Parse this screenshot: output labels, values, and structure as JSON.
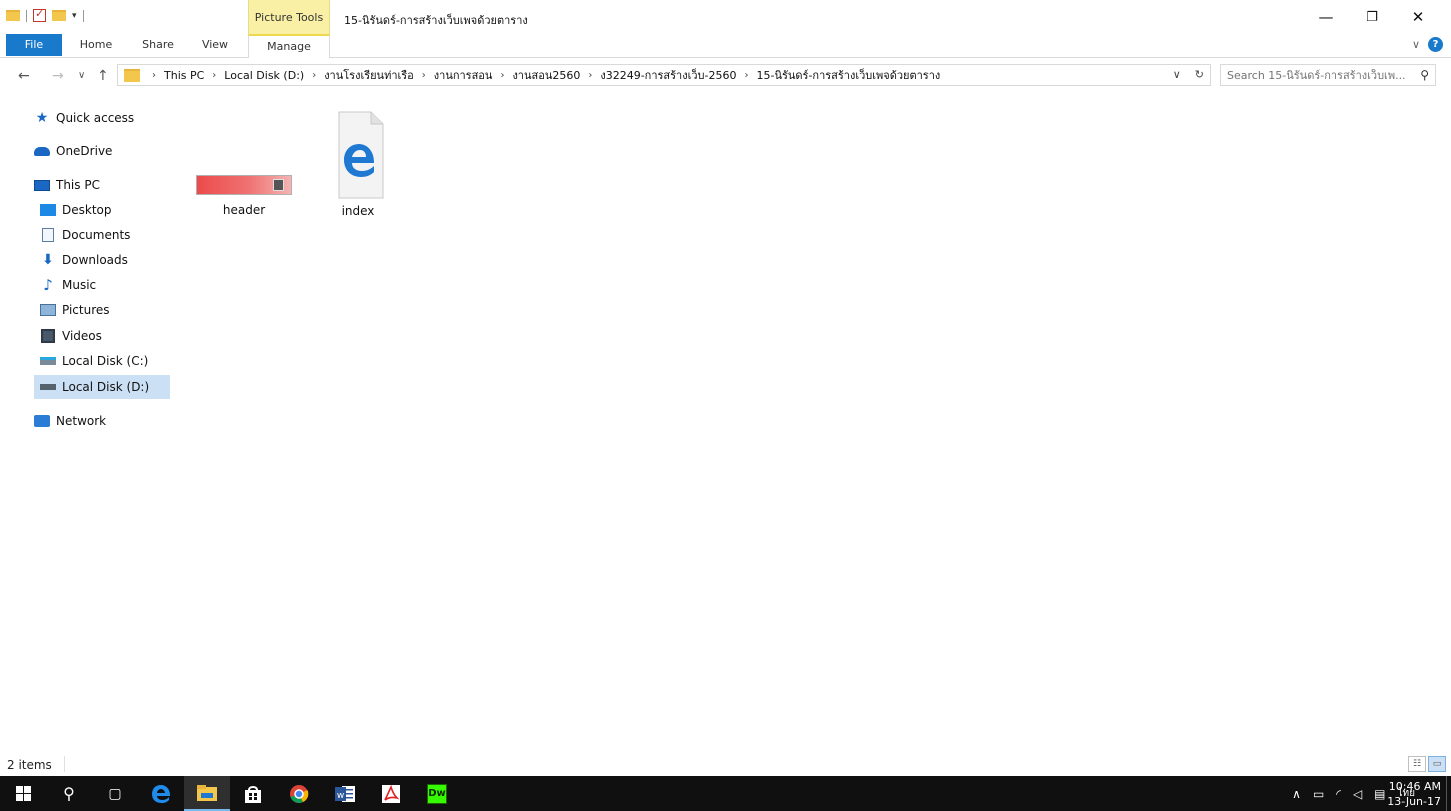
{
  "window": {
    "context_tab_group": "Picture Tools",
    "title": "15-นิรันดร์-การสร้างเว็บเพจด้วยตาราง",
    "minimize": "—",
    "restore": "❐",
    "close": "✕"
  },
  "ribbon": {
    "tabs": [
      {
        "label": "File"
      },
      {
        "label": "Home"
      },
      {
        "label": "Share"
      },
      {
        "label": "View"
      },
      {
        "label": "Manage"
      }
    ],
    "help": "?"
  },
  "address": {
    "crumbs": [
      "This PC",
      "Local Disk (D:)",
      "งานโรงเรียนท่าเรือ",
      "งานการสอน",
      "งานสอน2560",
      "ง32249-การสร้างเว็บ-2560",
      "15-นิรันดร์-การสร้างเว็บเพจด้วยตาราง"
    ],
    "search_placeholder": "Search 15-นิรันดร์-การสร้างเว็บเพ..."
  },
  "nav": {
    "items": [
      {
        "label": "Quick access",
        "icon": "quick-access-star-icon"
      },
      {
        "label": "OneDrive",
        "icon": "onedrive-cloud-icon"
      },
      {
        "label": "This PC",
        "icon": "this-pc-icon"
      },
      {
        "label": "Desktop",
        "icon": "desktop-icon"
      },
      {
        "label": "Documents",
        "icon": "documents-icon"
      },
      {
        "label": "Downloads",
        "icon": "downloads-icon"
      },
      {
        "label": "Music",
        "icon": "music-icon"
      },
      {
        "label": "Pictures",
        "icon": "pictures-icon"
      },
      {
        "label": "Videos",
        "icon": "videos-icon"
      },
      {
        "label": "Local Disk (C:)",
        "icon": "local-disk-c-icon"
      },
      {
        "label": "Local Disk (D:)",
        "icon": "local-disk-d-icon",
        "selected": true
      },
      {
        "label": "Network",
        "icon": "network-icon"
      }
    ]
  },
  "files": [
    {
      "name": "header",
      "type": "image",
      "icon": "image-thumbnail"
    },
    {
      "name": "index",
      "type": "html",
      "icon": "edge-html-file-icon"
    }
  ],
  "status": {
    "item_count": "2 items"
  },
  "taskbar": {
    "tray_language": "ไทย",
    "time": "10:46 AM",
    "date": "13-Jun-17",
    "apps": [
      "start",
      "search",
      "task-view",
      "edge",
      "file-explorer",
      "store",
      "chrome",
      "word",
      "acrobat",
      "dreamweaver"
    ],
    "dreamweaver_label": "Dw"
  },
  "colors": {
    "file_tab_blue": "#1979ca",
    "context_tab_yellow": "#f9f0a6",
    "selection_blue": "#cce0f5",
    "taskbar_black": "#101010"
  }
}
